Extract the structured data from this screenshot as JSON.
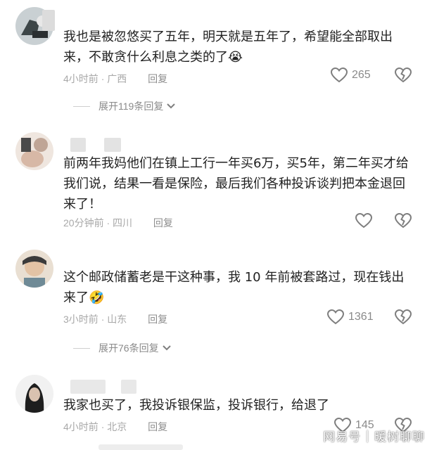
{
  "comments": [
    {
      "text": "我也是被忽悠买了五年，明天就是五年了，希望能全部取出来，不敢贪什么利息之类的了😭",
      "time": "4小时前",
      "location": "广西",
      "reply_label": "回复",
      "likes": "265",
      "expand_label": "展开119条回复"
    },
    {
      "text": "前两年我妈他们在镇上工行一年买6万，买5年，第二年买才给我们说，结果一看是保险，最后我们各种投诉谈判把本金退回来了！",
      "time": "20分钟前",
      "location": "四川",
      "reply_label": "回复",
      "likes": ""
    },
    {
      "text": "这个邮政储蓄老是干这种事，我 10 年前被套路过，现在钱出来了🤣",
      "time": "3小时前",
      "location": "山东",
      "reply_label": "回复",
      "likes": "1361",
      "expand_label": "展开76条回复"
    },
    {
      "text": "我家也买了，我投诉银保监，投诉银行，给退了",
      "time": "4小时前",
      "location": "北京",
      "reply_label": "回复",
      "likes": "145"
    }
  ],
  "separator": "·",
  "watermark": {
    "brand": "网易号",
    "account": "暖树聊聊"
  },
  "icons": {
    "like": "heart-outline-icon",
    "dislike": "broken-heart-icon",
    "expand": "chevron-down-icon"
  },
  "colors": {
    "meta_text": "#a8a8a8",
    "body_text": "#222222",
    "icon": "#8a8a8a"
  }
}
